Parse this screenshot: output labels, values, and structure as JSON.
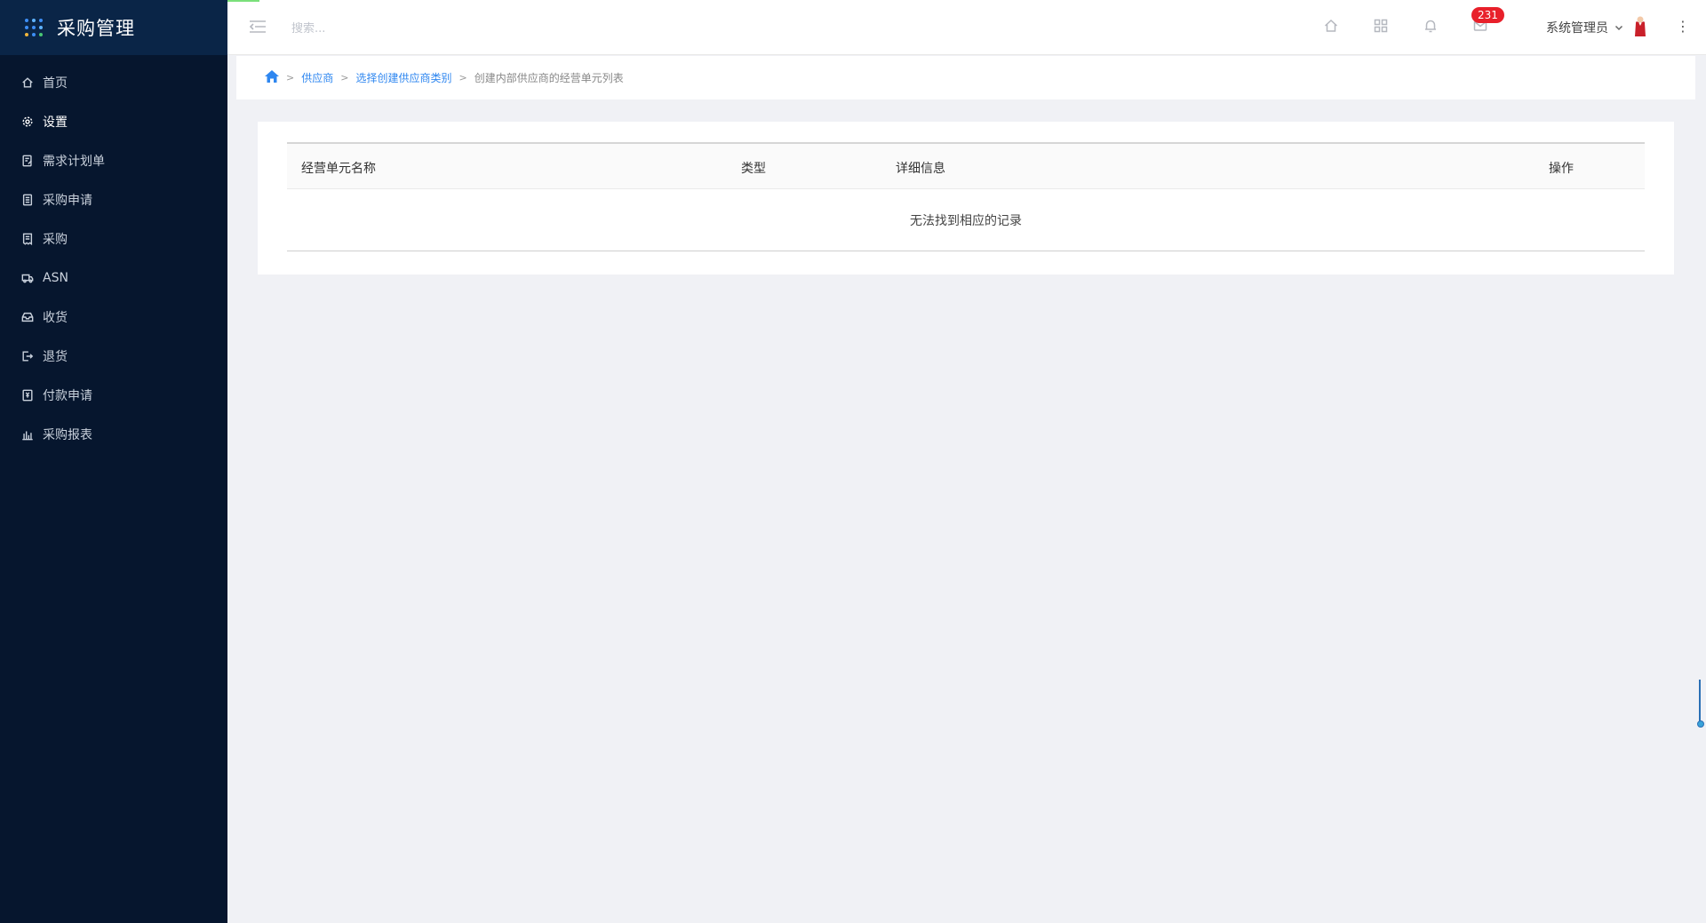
{
  "app": {
    "title": "采购管理",
    "accent_color": "#2f87f0",
    "sidebar_bg": "#06162e"
  },
  "sidebar": {
    "items": [
      {
        "label": "首页",
        "icon": "home-icon",
        "active": false
      },
      {
        "label": "设置",
        "icon": "gear-icon",
        "active": true
      },
      {
        "label": "需求计划单",
        "icon": "edit-doc-icon",
        "active": false
      },
      {
        "label": "采购申请",
        "icon": "clipboard-icon",
        "active": false
      },
      {
        "label": "采购",
        "icon": "receipt-icon",
        "active": false
      },
      {
        "label": "ASN",
        "icon": "truck-icon",
        "active": false
      },
      {
        "label": "收货",
        "icon": "inbox-icon",
        "active": false
      },
      {
        "label": "退货",
        "icon": "logout-icon",
        "active": false
      },
      {
        "label": "付款申请",
        "icon": "payment-doc-icon",
        "active": false
      },
      {
        "label": "采购报表",
        "icon": "bar-chart-icon",
        "active": false
      }
    ]
  },
  "header": {
    "search_placeholder": "搜索...",
    "notification_count": "231",
    "user_name": "系统管理员",
    "more": "⋮"
  },
  "breadcrumb": {
    "items": [
      {
        "label": "供应商",
        "link": true
      },
      {
        "label": "选择创建供应商类别",
        "link": true
      },
      {
        "label": "创建内部供应商的经营单元列表",
        "link": false
      }
    ],
    "separator": ">"
  },
  "table": {
    "columns": [
      "经营单元名称",
      "类型",
      "详细信息",
      "操作"
    ],
    "empty_message": "无法找到相应的记录"
  }
}
